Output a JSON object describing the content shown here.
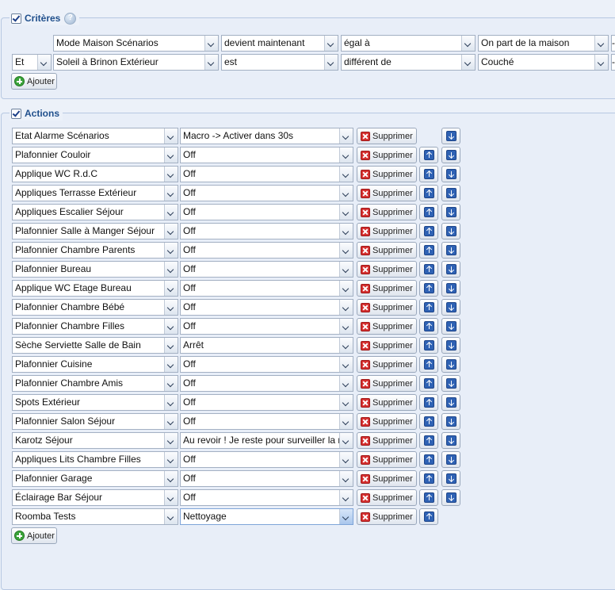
{
  "criteria": {
    "title": "Critères",
    "add_label": "Ajouter",
    "rows": [
      {
        "logic": "",
        "device": "Mode Maison Scénarios",
        "verb": "devient maintenant",
        "operator": "égal à",
        "value": "On part de la maison",
        "extra": "-"
      },
      {
        "logic": "Et",
        "device": "Soleil à Brinon Extérieur",
        "verb": "est",
        "operator": "différent de",
        "value": "Couché",
        "extra": "-"
      }
    ]
  },
  "actions": {
    "title": "Actions",
    "add_label": "Ajouter",
    "delete_label": "Supprimer",
    "rows": [
      {
        "device": "Etat Alarme Scénarios",
        "command": "Macro -> Activer dans 30s"
      },
      {
        "device": "Plafonnier Couloir",
        "command": "Off"
      },
      {
        "device": "Applique WC R.d.C",
        "command": "Off"
      },
      {
        "device": "Appliques Terrasse Extérieur",
        "command": "Off"
      },
      {
        "device": "Appliques Escalier Séjour",
        "command": "Off"
      },
      {
        "device": "Plafonnier Salle à Manger Séjour",
        "command": "Off"
      },
      {
        "device": "Plafonnier Chambre Parents",
        "command": "Off"
      },
      {
        "device": "Plafonnier Bureau",
        "command": "Off"
      },
      {
        "device": "Applique WC Etage Bureau",
        "command": "Off"
      },
      {
        "device": "Plafonnier Chambre Bébé",
        "command": "Off"
      },
      {
        "device": "Plafonnier Chambre Filles",
        "command": "Off"
      },
      {
        "device": "Sèche Serviette Salle de Bain",
        "command": "Arrêt"
      },
      {
        "device": "Plafonnier Cuisine",
        "command": "Off"
      },
      {
        "device": "Plafonnier Chambre Amis",
        "command": "Off"
      },
      {
        "device": "Spots Extérieur",
        "command": "Off"
      },
      {
        "device": "Plafonnier Salon Séjour",
        "command": "Off"
      },
      {
        "device": "Karotz Séjour",
        "command": "Au revoir ! Je reste pour surveiller la maison"
      },
      {
        "device": "Appliques Lits Chambre Filles",
        "command": "Off"
      },
      {
        "device": "Plafonnier Garage",
        "command": "Off"
      },
      {
        "device": "Éclairage Bar Séjour",
        "command": "Off"
      },
      {
        "device": "Roomba Tests",
        "command": "Nettoyage"
      }
    ]
  }
}
